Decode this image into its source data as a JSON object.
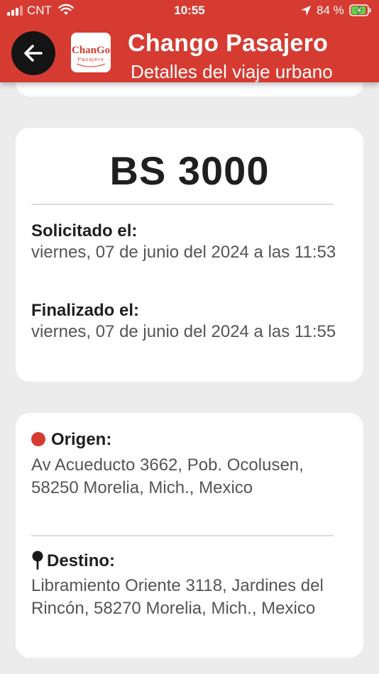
{
  "status_bar": {
    "carrier": "CNT",
    "time": "10:55",
    "battery": "84 %",
    "icons": [
      "signal-icon",
      "wifi-icon",
      "location-arrow-icon",
      "battery-charging-icon"
    ]
  },
  "app_bar": {
    "back_icon": "arrow-left-icon",
    "logo_text": "ChanGo",
    "logo_subtext": "Pasajero",
    "title": "Chango Pasajero",
    "subtitle": "Detalles del viaje urbano"
  },
  "trip": {
    "amount": "BS 3000",
    "requested_label": "Solicitado el:",
    "requested_value": "viernes, 07 de junio del 2024 a las 11:53",
    "finished_label": "Finalizado el:",
    "finished_value": "viernes, 07 de junio del 2024 a las 11:55"
  },
  "route": {
    "origin_label": "Origen:",
    "origin_value": "Av Acueducto 3662, Pob. Ocolusen, 58250 Morelia, Mich., Mexico",
    "destination_label": "Destino:",
    "destination_value": "Libramiento Oriente 3118, Jardines del Rincón, 58270 Morelia, Mich., Mexico"
  },
  "colors": {
    "primary": "#d63b32",
    "background": "#ececec",
    "card": "#ffffff",
    "back_button": "#141414"
  }
}
